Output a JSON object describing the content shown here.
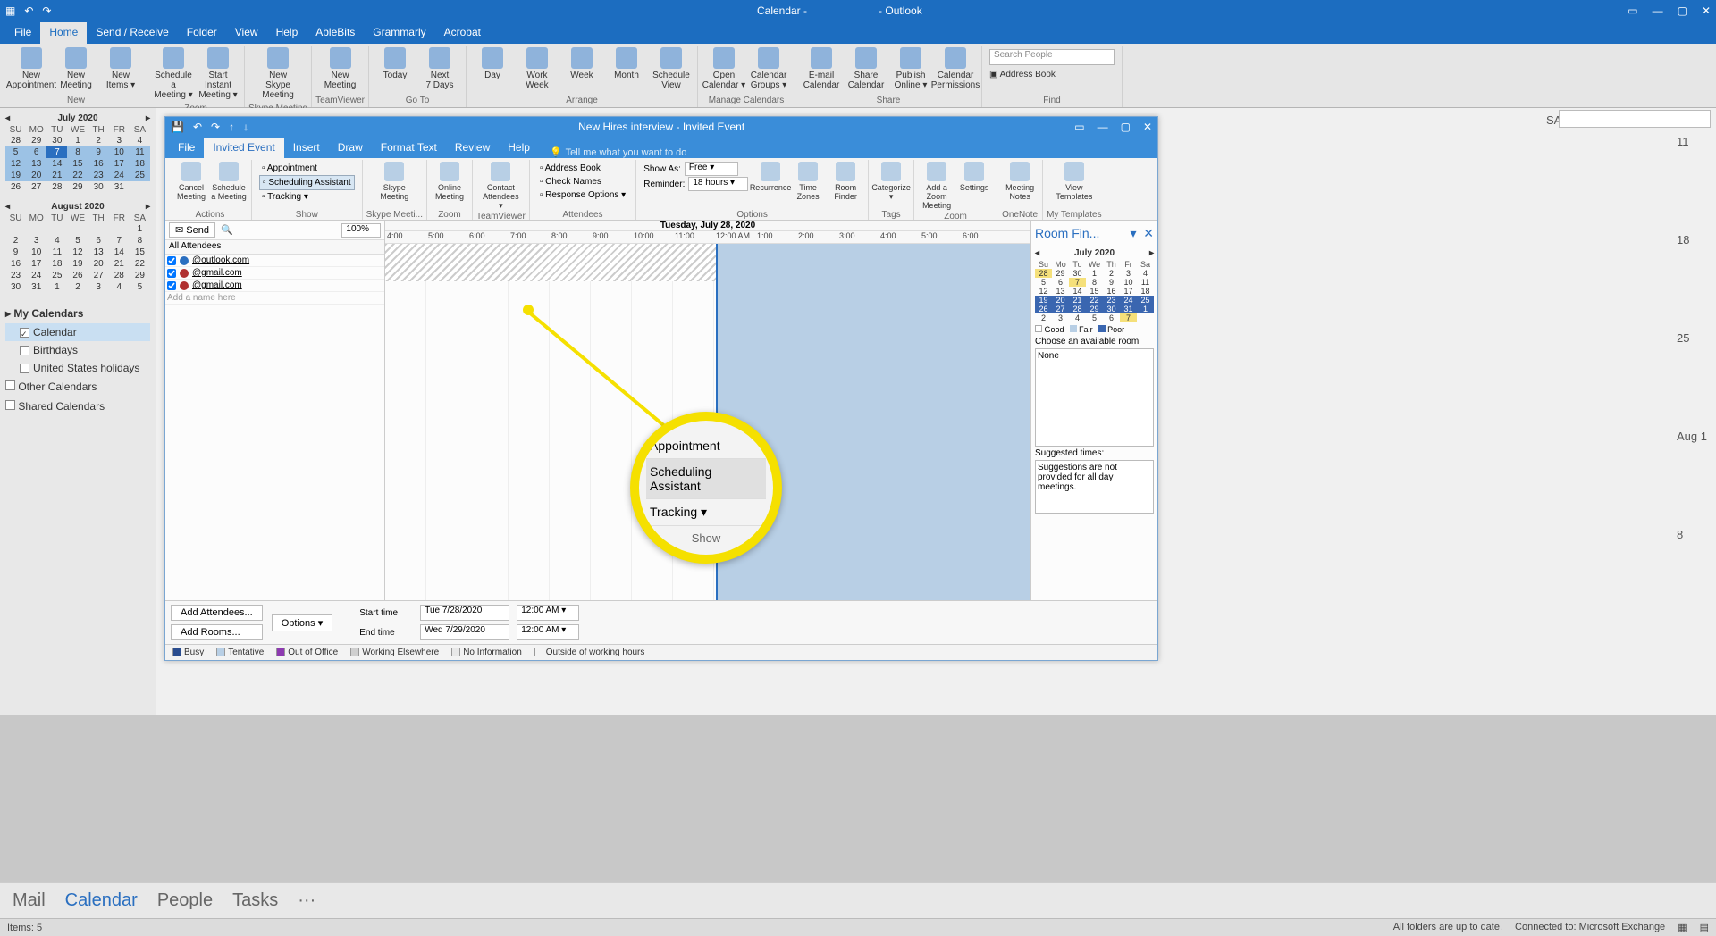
{
  "app": {
    "title_left": "Calendar -",
    "title_right": "- Outlook"
  },
  "win_controls": {
    "min": "—",
    "max": "▢",
    "close": "✕",
    "opts": "▭"
  },
  "tabs": [
    "File",
    "Home",
    "Send / Receive",
    "Folder",
    "View",
    "Help",
    "AbleBits",
    "Grammarly",
    "Acrobat"
  ],
  "active_tab": "Home",
  "ribbon_groups": [
    {
      "label": "New",
      "buttons": [
        {
          "label": "New\nAppointment",
          "icon": "calendar-icon"
        },
        {
          "label": "New\nMeeting",
          "icon": "calendar-people-icon"
        },
        {
          "label": "New\nItems ▾",
          "icon": "items-icon"
        }
      ]
    },
    {
      "label": "Zoom",
      "buttons": [
        {
          "label": "Schedule a\nMeeting ▾",
          "icon": "calendar-icon"
        },
        {
          "label": "Start Instant\nMeeting ▾",
          "icon": "zoom-icon"
        }
      ]
    },
    {
      "label": "Skype Meeting",
      "buttons": [
        {
          "label": "New Skype\nMeeting",
          "icon": "skype-icon"
        }
      ]
    },
    {
      "label": "TeamViewer",
      "buttons": [
        {
          "label": "New\nMeeting",
          "icon": "teamviewer-icon"
        }
      ]
    },
    {
      "label": "Go To",
      "buttons": [
        {
          "label": "Today",
          "icon": "today-icon"
        },
        {
          "label": "Next\n7 Days",
          "icon": "week-icon"
        }
      ]
    },
    {
      "label": "Arrange",
      "buttons": [
        {
          "label": "Day",
          "icon": "day-icon"
        },
        {
          "label": "Work\nWeek",
          "icon": "workweek-icon"
        },
        {
          "label": "Week",
          "icon": "week-icon"
        },
        {
          "label": "Month",
          "icon": "month-icon"
        },
        {
          "label": "Schedule\nView",
          "icon": "schedule-icon"
        }
      ]
    },
    {
      "label": "Manage Calendars",
      "buttons": [
        {
          "label": "Open\nCalendar ▾",
          "icon": "open-icon"
        },
        {
          "label": "Calendar\nGroups ▾",
          "icon": "groups-icon"
        }
      ]
    },
    {
      "label": "Share",
      "buttons": [
        {
          "label": "E-mail\nCalendar",
          "icon": "mail-icon"
        },
        {
          "label": "Share\nCalendar",
          "icon": "share-icon"
        },
        {
          "label": "Publish\nOnline ▾",
          "icon": "publish-icon"
        },
        {
          "label": "Calendar\nPermissions",
          "icon": "perm-icon"
        }
      ]
    },
    {
      "label": "Find",
      "search_placeholder": "Search People",
      "address_book": "Address Book"
    }
  ],
  "minical1": {
    "title": "July 2020",
    "dow": [
      "SU",
      "MO",
      "TU",
      "WE",
      "TH",
      "FR",
      "SA"
    ],
    "rows": [
      [
        "28",
        "29",
        "30",
        "1",
        "2",
        "3",
        "4"
      ],
      [
        "5",
        "6",
        "7",
        "8",
        "9",
        "10",
        "11"
      ],
      [
        "12",
        "13",
        "14",
        "15",
        "16",
        "17",
        "18"
      ],
      [
        "19",
        "20",
        "21",
        "22",
        "23",
        "24",
        "25"
      ],
      [
        "26",
        "27",
        "28",
        "29",
        "30",
        "31",
        ""
      ]
    ],
    "today": "7",
    "hl_rows": [
      1,
      2,
      3
    ]
  },
  "minical2": {
    "title": "August 2020",
    "dow": [
      "SU",
      "MO",
      "TU",
      "WE",
      "TH",
      "FR",
      "SA"
    ],
    "rows": [
      [
        "",
        "",
        "",
        "",
        "",
        "",
        "1"
      ],
      [
        "2",
        "3",
        "4",
        "5",
        "6",
        "7",
        "8"
      ],
      [
        "9",
        "10",
        "11",
        "12",
        "13",
        "14",
        "15"
      ],
      [
        "16",
        "17",
        "18",
        "19",
        "20",
        "21",
        "22"
      ],
      [
        "23",
        "24",
        "25",
        "26",
        "27",
        "28",
        "29"
      ],
      [
        "30",
        "31",
        "1",
        "2",
        "3",
        "4",
        "5"
      ]
    ]
  },
  "cal_groups": {
    "my": "My Calendars",
    "items": [
      {
        "label": "Calendar",
        "checked": true,
        "sel": true
      },
      {
        "label": "Birthdays",
        "checked": false
      },
      {
        "label": "United States holidays",
        "checked": false
      }
    ],
    "other": "Other Calendars",
    "shared": "Shared Calendars"
  },
  "bg_calendar": {
    "saturday": "SATURDAY",
    "days": [
      "11",
      "18",
      "25",
      "Aug 1",
      "8"
    ]
  },
  "event_win": {
    "title": "New Hires interview  -  Invited Event",
    "tabs": [
      "File",
      "Invited Event",
      "Insert",
      "Draw",
      "Format Text",
      "Review",
      "Help"
    ],
    "active": "Invited Event",
    "tell_me": "Tell me what you want to do",
    "ribbon": [
      {
        "label": "Actions",
        "big": [
          {
            "l": "Cancel\nMeeting",
            "i": "delete-icon"
          },
          {
            "l": "Schedule\na Meeting",
            "i": "calendar-icon"
          }
        ]
      },
      {
        "label": "Show",
        "stack": [
          "Appointment",
          "Scheduling Assistant",
          "Tracking  ▾"
        ]
      },
      {
        "label": "Skype Meeti...",
        "big": [
          {
            "l": "Skype\nMeeting",
            "i": "skype-icon"
          }
        ]
      },
      {
        "label": "Zoom",
        "big": [
          {
            "l": "Online\nMeeting",
            "i": "zoom-icon"
          }
        ]
      },
      {
        "label": "TeamViewer",
        "big": [
          {
            "l": "Contact\nAttendees ▾",
            "i": "teamviewer-icon"
          }
        ]
      },
      {
        "label": "Attendees",
        "stack": [
          "Address Book",
          "Check Names",
          "Response Options ▾"
        ]
      },
      {
        "label": "Options",
        "rows": [
          {
            "k": "Show As:",
            "v": "Free"
          },
          {
            "k": "Reminder:",
            "v": "18 hours"
          }
        ],
        "big": [
          {
            "l": "Recurrence",
            "i": "recur-icon"
          },
          {
            "l": "Time\nZones",
            "i": "tz-icon"
          },
          {
            "l": "Room\nFinder",
            "i": "roomfinder-icon"
          }
        ]
      },
      {
        "label": "Tags",
        "big": [
          {
            "l": "Categorize\n▾",
            "i": "categorize-icon"
          }
        ]
      },
      {
        "label": "Zoom",
        "big": [
          {
            "l": "Add a Zoom\nMeeting",
            "i": "zoom-icon"
          },
          {
            "l": "Settings",
            "i": "gear-icon"
          }
        ]
      },
      {
        "label": "OneNote",
        "big": [
          {
            "l": "Meeting\nNotes",
            "i": "onenote-icon"
          }
        ]
      },
      {
        "label": "My Templates",
        "big": [
          {
            "l": "View\nTemplates",
            "i": "templates-icon"
          }
        ]
      }
    ],
    "send": "Send",
    "zoom": "100%",
    "attendees_hdr": "All Attendees",
    "attendees": [
      {
        "email": "@outlook.com",
        "status": "organizer"
      },
      {
        "email": "@gmail.com",
        "status": "required"
      },
      {
        "email": "@gmail.com",
        "status": "required"
      }
    ],
    "add_name": "Add a name here",
    "date_header": "Tuesday, July 28, 2020",
    "hours": [
      "4:00",
      "5:00",
      "6:00",
      "7:00",
      "8:00",
      "9:00",
      "10:00",
      "11:00",
      "12:00 AM",
      "1:00",
      "2:00",
      "3:00",
      "4:00",
      "5:00",
      "6:00"
    ],
    "add_attendees": "Add Attendees...",
    "add_rooms": "Add Rooms...",
    "options_btn": "Options ▾",
    "start_label": "Start time",
    "end_label": "End time",
    "start_date": "Tue 7/28/2020",
    "end_date": "Wed 7/29/2020",
    "start_time": "12:00 AM",
    "end_time": "12:00 AM",
    "legend": [
      "Busy",
      "Tentative",
      "Out of Office",
      "Working Elsewhere",
      "No Information",
      "Outside of working hours"
    ],
    "legend_colors": [
      "#2a4d8f",
      "#b8cfe5",
      "#8d3ab0",
      "#cfcfcf",
      "#e8e8e8",
      "#f3f3f3"
    ]
  },
  "room_finder": {
    "title": "Room Fin...",
    "month": "July 2020",
    "dow": [
      "Su",
      "Mo",
      "Tu",
      "We",
      "Th",
      "Fr",
      "Sa"
    ],
    "rows": [
      [
        "28",
        "29",
        "30",
        "1",
        "2",
        "3",
        "4"
      ],
      [
        "5",
        "6",
        "7",
        "8",
        "9",
        "10",
        "11"
      ],
      [
        "12",
        "13",
        "14",
        "15",
        "16",
        "17",
        "18"
      ],
      [
        "19",
        "20",
        "21",
        "22",
        "23",
        "24",
        "25"
      ],
      [
        "26",
        "27",
        "28",
        "29",
        "30",
        "31",
        "1"
      ],
      [
        "2",
        "3",
        "4",
        "5",
        "6",
        "7",
        ""
      ]
    ],
    "today": "7",
    "sel": "28",
    "legend": {
      "good": "Good",
      "fair": "Fair",
      "poor": "Poor"
    },
    "choose": "Choose an available room:",
    "none": "None",
    "suggested": "Suggested times:",
    "sugg_text": "Suggestions are not provided for all day meetings."
  },
  "magnifier": {
    "items": [
      "Appointment",
      "Scheduling Assistant",
      "Tracking   ▾"
    ],
    "label": "Show"
  },
  "bottom_nav": [
    "Mail",
    "Calendar",
    "People",
    "Tasks",
    "···"
  ],
  "bottom_active": "Calendar",
  "status": {
    "items": "Items: 5",
    "folders": "All folders are up to date.",
    "connected": "Connected to: Microsoft Exchange"
  }
}
